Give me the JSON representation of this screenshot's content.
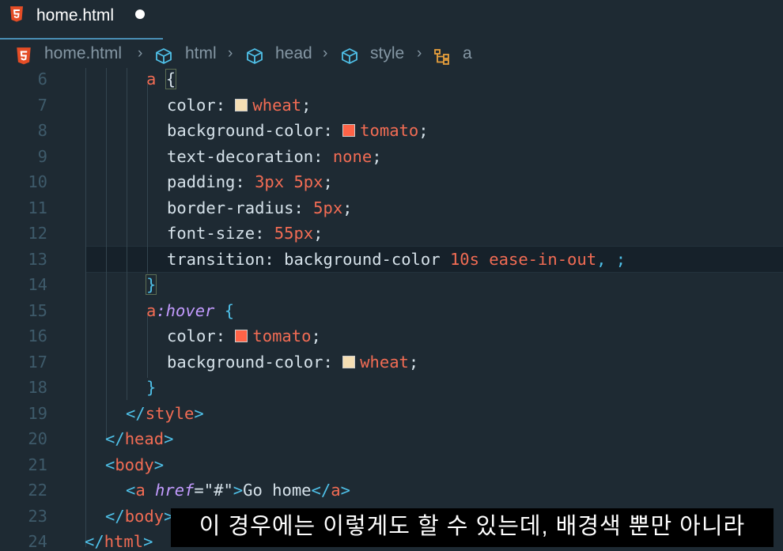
{
  "tab": {
    "filename": "home.html",
    "unsaved_indicator": "●"
  },
  "breadcrumb": [
    "home.html",
    "html",
    "head",
    "style",
    "a"
  ],
  "line_numbers": [
    "6",
    "7",
    "8",
    "9",
    "10",
    "11",
    "12",
    "13",
    "14",
    "15",
    "16",
    "17",
    "18",
    "19",
    "20",
    "21",
    "22",
    "23",
    "24"
  ],
  "code": {
    "l6": {
      "sel": "a",
      "brace": "{"
    },
    "l7": {
      "prop": "color",
      "value": "wheat",
      "swatch": "#f5deb3"
    },
    "l8": {
      "prop": "background-color",
      "value": "tomato",
      "swatch": "#ff6347"
    },
    "l9": {
      "prop": "text-decoration",
      "value": "none"
    },
    "l10": {
      "prop": "padding",
      "value": "3px 5px"
    },
    "l11": {
      "prop": "border-radius",
      "value": "5px"
    },
    "l12": {
      "prop": "font-size",
      "value": "55px"
    },
    "l13": {
      "prop": "transition",
      "value_a": "background-color",
      "value_b": "10s ease-in-out",
      "tail": ", ;"
    },
    "l14": {
      "brace": "}"
    },
    "l15": {
      "sel": "a",
      "pseudo": ":hover",
      "brace": "{"
    },
    "l16": {
      "prop": "color",
      "value": "tomato",
      "swatch": "#ff6347"
    },
    "l17": {
      "prop": "background-color",
      "value": "wheat",
      "swatch": "#f5deb3"
    },
    "l18": {
      "brace": "}"
    },
    "l19": {
      "open": "</",
      "tag": "style",
      "close": ">"
    },
    "l20": {
      "open": "</",
      "tag": "head",
      "close": ">"
    },
    "l21": {
      "open": "<",
      "tag": "body",
      "close": ">"
    },
    "l22": {
      "open": "<",
      "tag": "a",
      "attr": "href",
      "eq": "=",
      "q": "\"",
      "aval": "#",
      "text": "Go home",
      "etag": "a"
    },
    "l23": {
      "open": "</",
      "tag": "body",
      "close": ">"
    },
    "l24": {
      "open": "</",
      "tag": "html",
      "close": ">"
    }
  },
  "subtitle": "이 경우에는 이렇게도 할 수 있는데, 배경색 뿐만 아니라",
  "colors": {
    "background": "#1e2a33",
    "tag": "#4fc1e9",
    "value": "#f26c54",
    "keyword": "#c39bff",
    "tab_underline": "#4a8fb6"
  }
}
